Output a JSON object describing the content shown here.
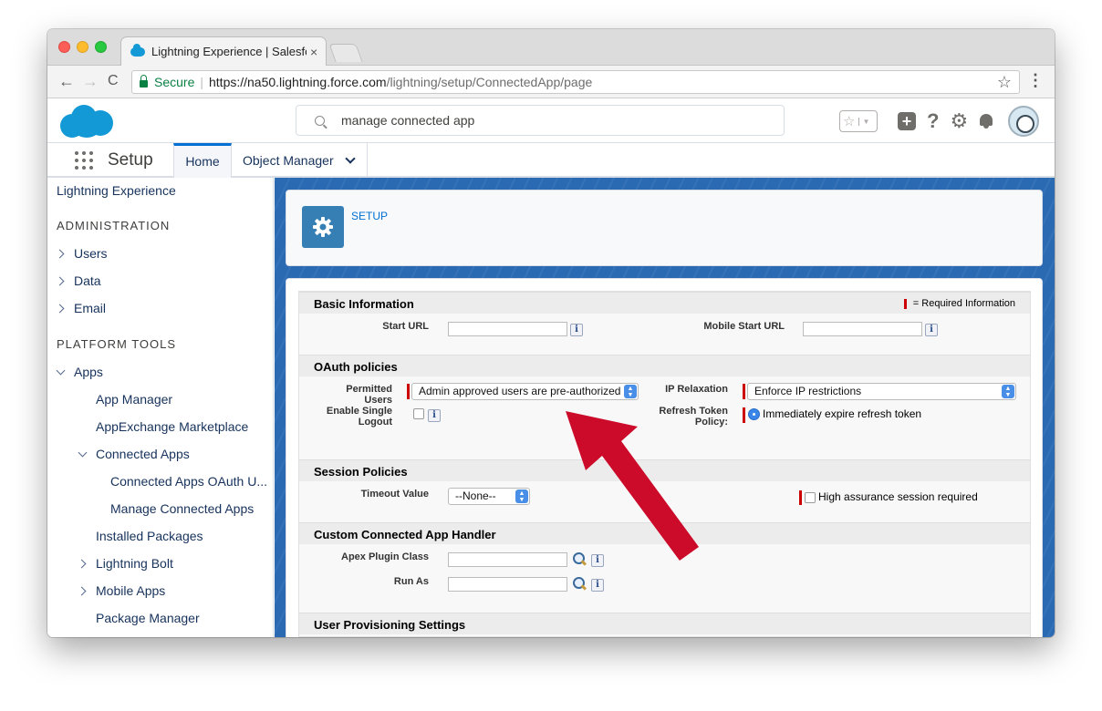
{
  "browser": {
    "tab_title": "Lightning Experience | Salesforce",
    "tab_close": "×",
    "secure_label": "Secure",
    "url_scheme_host": "https://na50.lightning.force.com",
    "url_path": "/lightning/setup/ConnectedApp/page",
    "star": "☆",
    "menu": "⋮",
    "back": "←",
    "forward": "→",
    "reload": "C"
  },
  "header": {
    "search_value": "manage connected app",
    "help": "?",
    "plus": "+",
    "gear": "⚙",
    "fav_star": "☆",
    "fav_caret": "▼"
  },
  "nav": {
    "app_name": "Setup",
    "tabs": [
      {
        "label": "Home"
      },
      {
        "label": "Object Manager"
      }
    ]
  },
  "sidebar": {
    "top_item": "Lightning Experience",
    "admin_heading": "ADMINISTRATION",
    "admin_items": [
      "Users",
      "Data",
      "Email"
    ],
    "platform_heading": "PLATFORM TOOLS",
    "apps_label": "Apps",
    "apps_children": [
      "App Manager",
      "AppExchange Marketplace"
    ],
    "connected_apps_label": "Connected Apps",
    "connected_apps_children": [
      "Connected Apps OAuth U...",
      "Manage Connected Apps"
    ],
    "more_items": [
      "Installed Packages",
      "Lightning Bolt",
      "Mobile Apps",
      "Package Manager"
    ]
  },
  "page_header": {
    "label": "SETUP"
  },
  "form": {
    "required_legend": "= Required Information",
    "sections": {
      "basic": {
        "title": "Basic Information",
        "start_url_label": "Start URL",
        "mobile_start_url_label": "Mobile Start URL"
      },
      "oauth": {
        "title": "OAuth policies",
        "permitted_users_label": "Permitted Users",
        "permitted_users_value": "Admin approved users are pre-authorized",
        "ip_relaxation_label": "IP Relaxation",
        "ip_relaxation_value": "Enforce IP restrictions",
        "single_logout_label_1": "Enable Single",
        "single_logout_label_2": "Logout",
        "refresh_label_1": "Refresh Token",
        "refresh_label_2": "Policy:",
        "refresh_value": "Immediately expire refresh token"
      },
      "session": {
        "title": "Session Policies",
        "timeout_label": "Timeout Value",
        "timeout_value": "--None--",
        "high_assurance_label": "High assurance session required"
      },
      "handler": {
        "title": "Custom Connected App Handler",
        "apex_label": "Apex Plugin Class",
        "run_as_label": "Run As"
      },
      "provisioning": {
        "title": "User Provisioning Settings"
      }
    },
    "info_glyph": "i"
  },
  "colors": {
    "brand_blue": "#139ad6",
    "link_blue": "#0070d2",
    "annotation_arrow": "#cc0a2a",
    "required_red": "#cc0000"
  }
}
